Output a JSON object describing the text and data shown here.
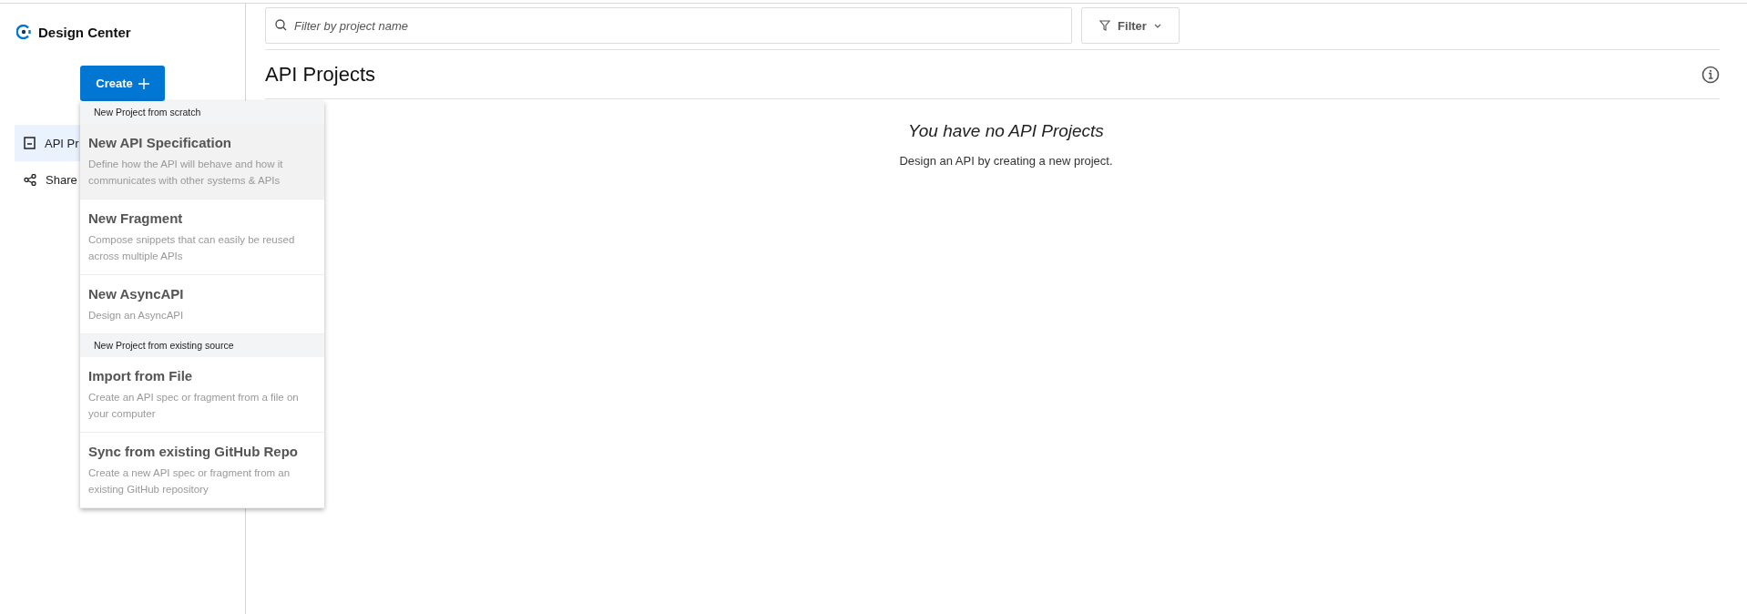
{
  "brand": {
    "title": "Design Center"
  },
  "create_button": {
    "label": "Create"
  },
  "sidebar": {
    "items": [
      {
        "label": "API Pr",
        "selected": true,
        "kind": "folder"
      },
      {
        "label": "Share",
        "selected": false,
        "kind": "share"
      }
    ]
  },
  "create_menu": {
    "entries": [
      {
        "kind": "header",
        "label": "New Project from scratch"
      },
      {
        "kind": "item",
        "title": "New API Specification",
        "description": "Define how the API will behave and how it communicates with other systems & APIs",
        "highlighted": true
      },
      {
        "kind": "item",
        "title": "New Fragment",
        "description": "Compose snippets that can easily be reused across multiple APIs",
        "highlighted": false
      },
      {
        "kind": "item",
        "title": "New AsyncAPI",
        "description": "Design an AsyncAPI",
        "highlighted": false
      },
      {
        "kind": "header",
        "label": "New Project from existing source"
      },
      {
        "kind": "item",
        "title": "Import from File",
        "description": "Create an API spec or fragment from a file on your computer",
        "highlighted": false
      },
      {
        "kind": "item",
        "title": "Sync from existing GitHub Repo",
        "description": "Create a new API spec or fragment from an existing GitHub repository",
        "highlighted": false
      }
    ]
  },
  "search": {
    "placeholder": "Filter by project name"
  },
  "filter_button": {
    "label": "Filter"
  },
  "page_title": "API Projects",
  "empty_state": {
    "heading": "You have no API Projects",
    "message": "Design an API by creating a new project."
  }
}
